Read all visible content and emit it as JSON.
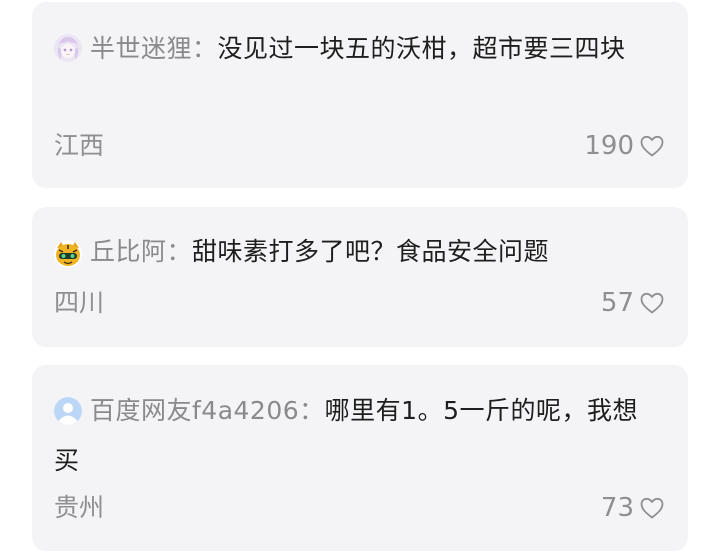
{
  "comments": [
    {
      "avatar_icon": "anime-girl-avatar-icon",
      "username": "半世迷狸",
      "separator": "：",
      "text": "没见过一块五的沃柑，超市要三四块",
      "location": "江西",
      "likes": "190"
    },
    {
      "avatar_icon": "tiger-mask-avatar-icon",
      "username": "丘比阿",
      "separator": "：",
      "text": "甜味素打多了吧？食品安全问题",
      "location": "四川",
      "likes": "57"
    },
    {
      "avatar_icon": "default-user-avatar-icon",
      "username": "百度网友f4a4206",
      "separator": "：",
      "text": "哪里有1。5一斤的呢，我想买",
      "location": "贵州",
      "likes": "73"
    }
  ],
  "colors": {
    "card_background": "#f4f4f6",
    "secondary_text": "#8e8e93",
    "primary_text": "#1e1e1e"
  }
}
